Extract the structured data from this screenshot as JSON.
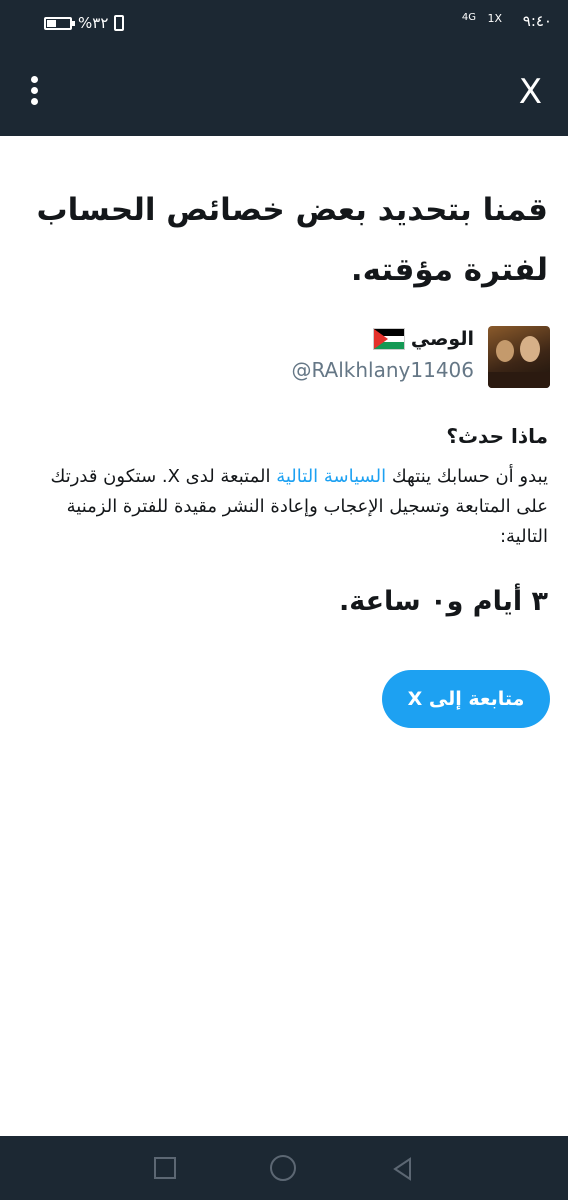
{
  "status_bar": {
    "time": "٩:٤٠",
    "network_1": "1X",
    "network_2": "4G",
    "battery_percent": "%٣٢",
    "battery_level": 0.32
  },
  "app_bar": {
    "close_label": "X",
    "menu_icon": "more-vertical-icon"
  },
  "notice": {
    "headline": "قمنا بتحديد بعض خصائص الحساب لفترة مؤقته.",
    "account": {
      "name": "الوصي",
      "handle": "@RAlkhlany11406"
    },
    "what_happened_title": "ماذا حدث؟",
    "body_prefix": "يبدو أن حسابك ينتهك ",
    "body_link": "السياسة التالية",
    "body_suffix": " المتبعة لدى X. ستكون قدرتك على المتابعة وتسجيل الإعجاب وإعادة النشر مقيدة للفترة الزمنية التالية:",
    "duration": "٣ أيام و٠ ساعة.",
    "continue_button": "متابعة إلى X"
  },
  "colors": {
    "bar_bg": "#1c2833",
    "accent": "#1da1f2",
    "muted": "#657786"
  }
}
